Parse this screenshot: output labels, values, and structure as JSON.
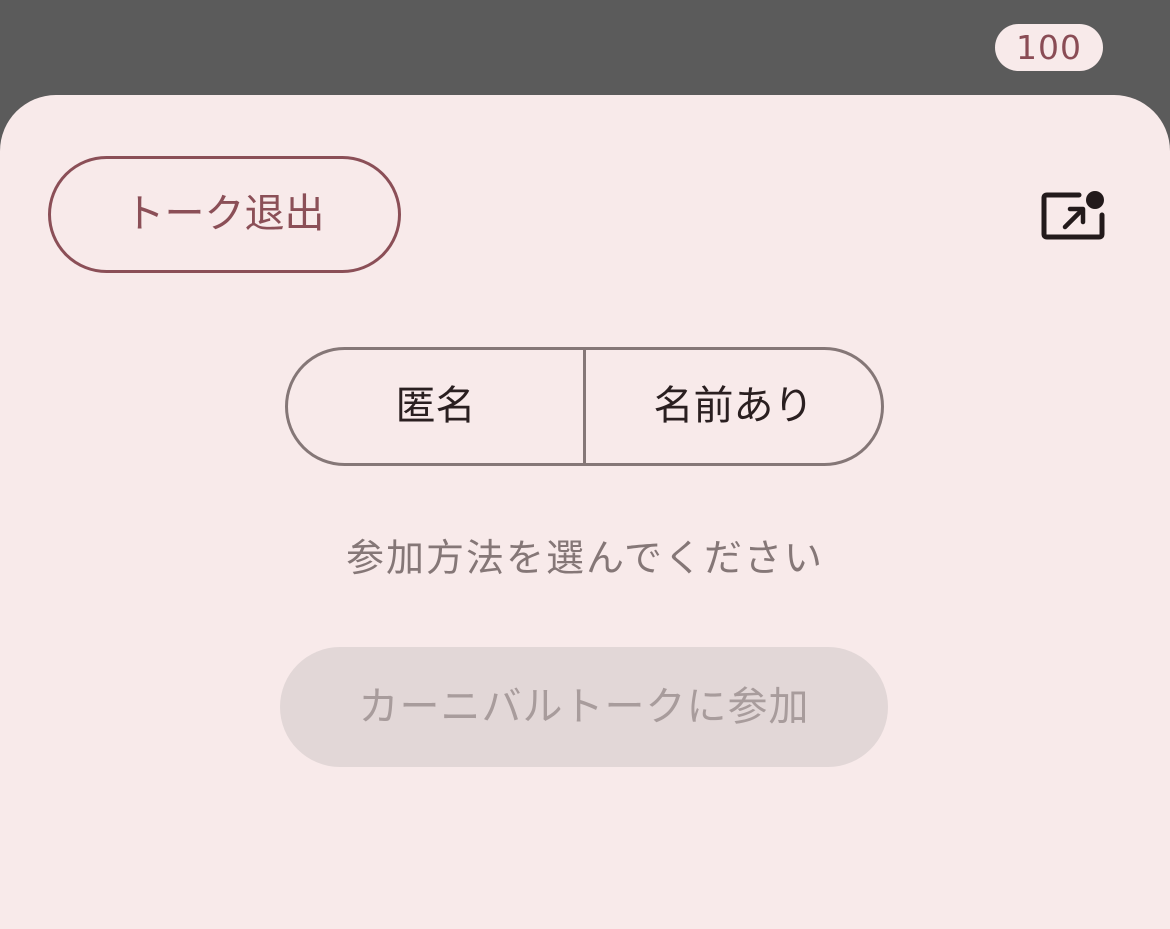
{
  "status_badge": {
    "text": "100"
  },
  "sheet": {
    "exit_button_label": "トーク退出",
    "pip_icon": "picture-in-picture-icon",
    "segments": [
      {
        "label": "匿名"
      },
      {
        "label": "名前あり"
      }
    ],
    "hint_text": "参加方法を選んでください",
    "join_button_label": "カーニバルトークに参加"
  },
  "colors": {
    "background_dark": "#5b5b5b",
    "sheet_background": "#f8eaea",
    "accent": "#8b4f57",
    "outline": "#857777",
    "disabled_fill": "#e2d7d7",
    "disabled_text": "#a89c9c"
  }
}
